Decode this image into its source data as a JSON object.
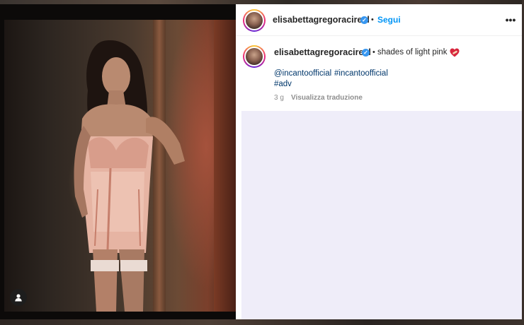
{
  "post": {
    "username": "elisabetta.gregoraci.real",
    "username_display": "elisabettagregoracireal",
    "follow_label": "Segui",
    "separator": "•",
    "more_label": "•••"
  },
  "caption": {
    "text": "shades of light pink",
    "emoji_icon": "heart-with-bandage-icon",
    "mentions": [
      "@incantoofficial",
      "#incantoofficial"
    ],
    "hashtag": "#adv",
    "time_ago": "3 g",
    "translate_label": "Visualizza traduzione"
  },
  "colors": {
    "accent": "#0095f6",
    "link": "#00376b",
    "verified": "#3897f0",
    "comments_bg": "#efedf9"
  }
}
